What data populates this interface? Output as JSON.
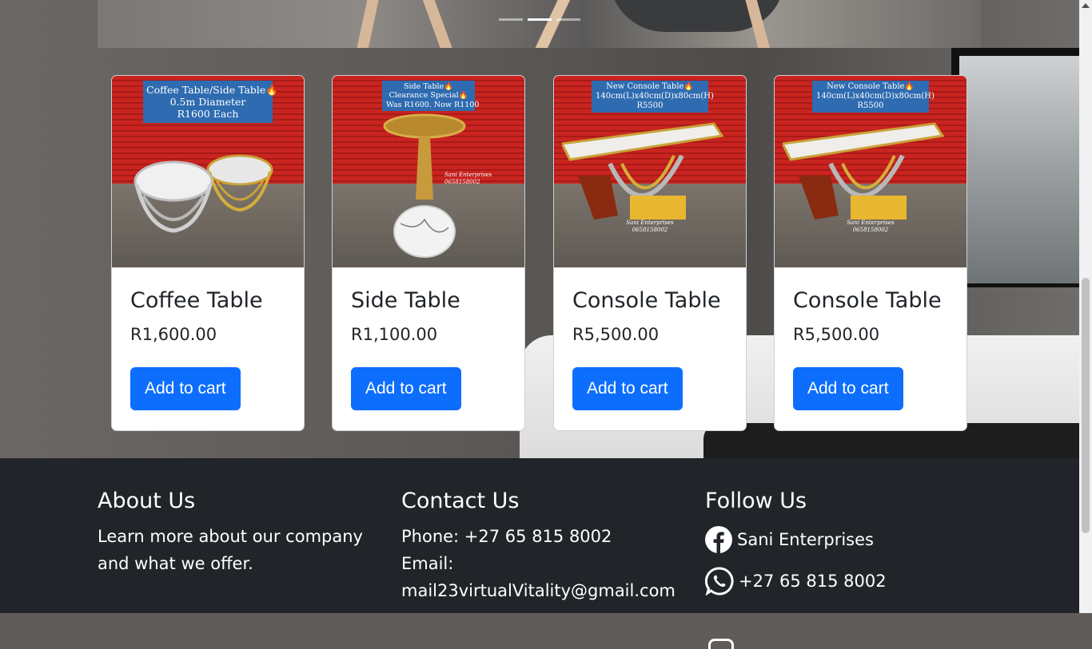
{
  "hero": {
    "indicator_count": 3,
    "active_index": 1
  },
  "products": [
    {
      "caption_lines": [
        "Coffee Table/Side Table🔥",
        "0.5m Diameter",
        "R1600 Each"
      ],
      "title": "Coffee Table",
      "price": "R1,600.00",
      "button": "Add to cart"
    },
    {
      "caption_lines": [
        "Side Table🔥",
        "Clearance Special🔥",
        "Was R1600. Now R1100"
      ],
      "watermark": "Sani Enterprises 0658158002",
      "title": "Side Table",
      "price": "R1,100.00",
      "button": "Add to cart"
    },
    {
      "caption_lines": [
        "New Console Table🔥",
        "140cm(L)x40cm(D)x80cm(H)",
        "R5500"
      ],
      "watermark": "Sani Enterprises 0658158002",
      "title": "Console Table",
      "price": "R5,500.00",
      "button": "Add to cart"
    },
    {
      "caption_lines": [
        "New Console Table🔥",
        "140cm(L)x40cm(D)x80cm(H)",
        "R5500"
      ],
      "watermark": "Sani Enterprises 0658158002",
      "title": "Console Table",
      "price": "R5,500.00",
      "button": "Add to cart"
    }
  ],
  "footer": {
    "about": {
      "heading": "About Us",
      "line1": "Learn more about our company",
      "line2": "and what we offer."
    },
    "contact": {
      "heading": "Contact Us",
      "phone": "Phone: +27 65 815 8002",
      "email_label": "Email:",
      "email": "mail23virtualVitality@gmail.com"
    },
    "follow": {
      "heading": "Follow Us",
      "facebook": "Sani Enterprises",
      "whatsapp": "+27 65 815 8002",
      "facebook_icon": "facebook-icon",
      "whatsapp_icon": "whatsapp-icon"
    }
  },
  "colors": {
    "primary_button": "#0d6efd",
    "footer_bg": "#212529",
    "caption_bg": "#2e6bb0"
  }
}
